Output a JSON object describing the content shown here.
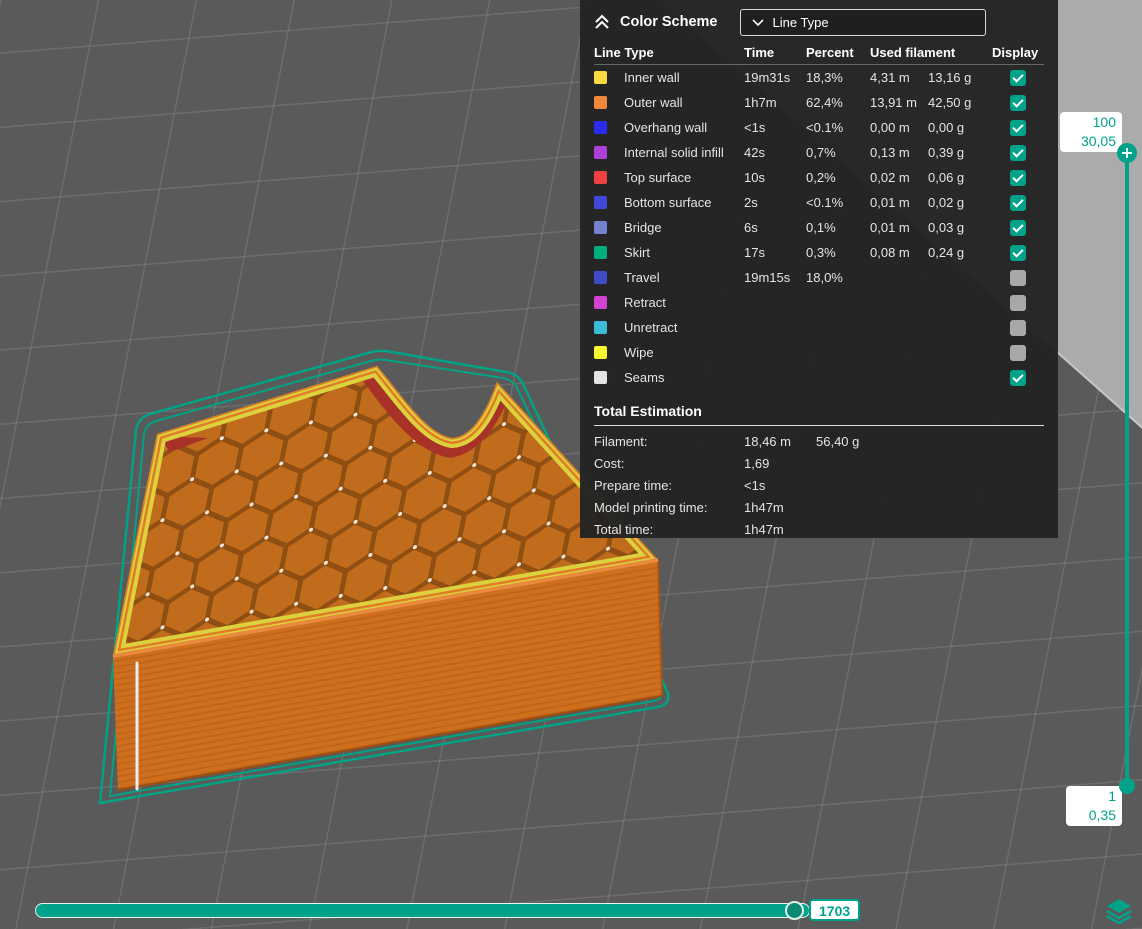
{
  "colors": {
    "accent": "#00A38A",
    "panel_bg": "#232323"
  },
  "panel": {
    "title": "Color Scheme",
    "dropdown": {
      "value": "Line Type"
    },
    "table": {
      "headers": {
        "line_type": "Line Type",
        "time": "Time",
        "percent": "Percent",
        "used_filament": "Used filament",
        "display": "Display"
      },
      "rows": [
        {
          "label": "Inner wall",
          "color": "#f9d93f",
          "time": "19m31s",
          "percent": "18,3%",
          "used_m": "4,31 m",
          "used_g": "13,16 g",
          "display": true
        },
        {
          "label": "Outer wall",
          "color": "#f0883c",
          "time": "1h7m",
          "percent": "62,4%",
          "used_m": "13,91 m",
          "used_g": "42,50 g",
          "display": true
        },
        {
          "label": "Overhang wall",
          "color": "#2b2bf0",
          "time": "<1s",
          "percent": "<0.1%",
          "used_m": "0,00 m",
          "used_g": "0,00 g",
          "display": true
        },
        {
          "label": "Internal solid infill",
          "color": "#ac41d8",
          "time": "42s",
          "percent": "0,7%",
          "used_m": "0,13 m",
          "used_g": "0,39 g",
          "display": true
        },
        {
          "label": "Top surface",
          "color": "#ee4040",
          "time": "10s",
          "percent": "0,2%",
          "used_m": "0,02 m",
          "used_g": "0,06 g",
          "display": true
        },
        {
          "label": "Bottom surface",
          "color": "#4248d8",
          "time": "2s",
          "percent": "<0.1%",
          "used_m": "0,01 m",
          "used_g": "0,02 g",
          "display": true
        },
        {
          "label": "Bridge",
          "color": "#7382ce",
          "time": "6s",
          "percent": "0,1%",
          "used_m": "0,01 m",
          "used_g": "0,03 g",
          "display": true
        },
        {
          "label": "Skirt",
          "color": "#00ad7c",
          "time": "17s",
          "percent": "0,3%",
          "used_m": "0,08 m",
          "used_g": "0,24 g",
          "display": true
        },
        {
          "label": "Travel",
          "color": "#3e4cc8",
          "time": "19m15s",
          "percent": "18,0%",
          "used_m": "",
          "used_g": "",
          "display": false
        },
        {
          "label": "Retract",
          "color": "#d343d3",
          "time": "",
          "percent": "",
          "used_m": "",
          "used_g": "",
          "display": false
        },
        {
          "label": "Unretract",
          "color": "#39bcd6",
          "time": "",
          "percent": "",
          "used_m": "",
          "used_g": "",
          "display": false
        },
        {
          "label": "Wipe",
          "color": "#f8f832",
          "time": "",
          "percent": "",
          "used_m": "",
          "used_g": "",
          "display": false
        },
        {
          "label": "Seams",
          "color": "#e3e3e3",
          "time": "",
          "percent": "",
          "used_m": "",
          "used_g": "",
          "display": true
        }
      ]
    },
    "total_estimation": {
      "title": "Total Estimation",
      "rows": [
        {
          "label": "Filament:",
          "value": "18,46 m",
          "value2": "56,40 g"
        },
        {
          "label": "Cost:",
          "value": "1,69",
          "value2": ""
        },
        {
          "label": "Prepare time:",
          "value": "<1s",
          "value2": ""
        },
        {
          "label": "Model printing time:",
          "value": "1h47m",
          "value2": ""
        },
        {
          "label": "Total time:",
          "value": "1h47m",
          "value2": ""
        }
      ]
    }
  },
  "layer_slider": {
    "top_value": "100",
    "top_height": "30,05",
    "bottom_value": "1",
    "bottom_height": "0,35"
  },
  "horizontal_slider": {
    "value": "1703"
  }
}
